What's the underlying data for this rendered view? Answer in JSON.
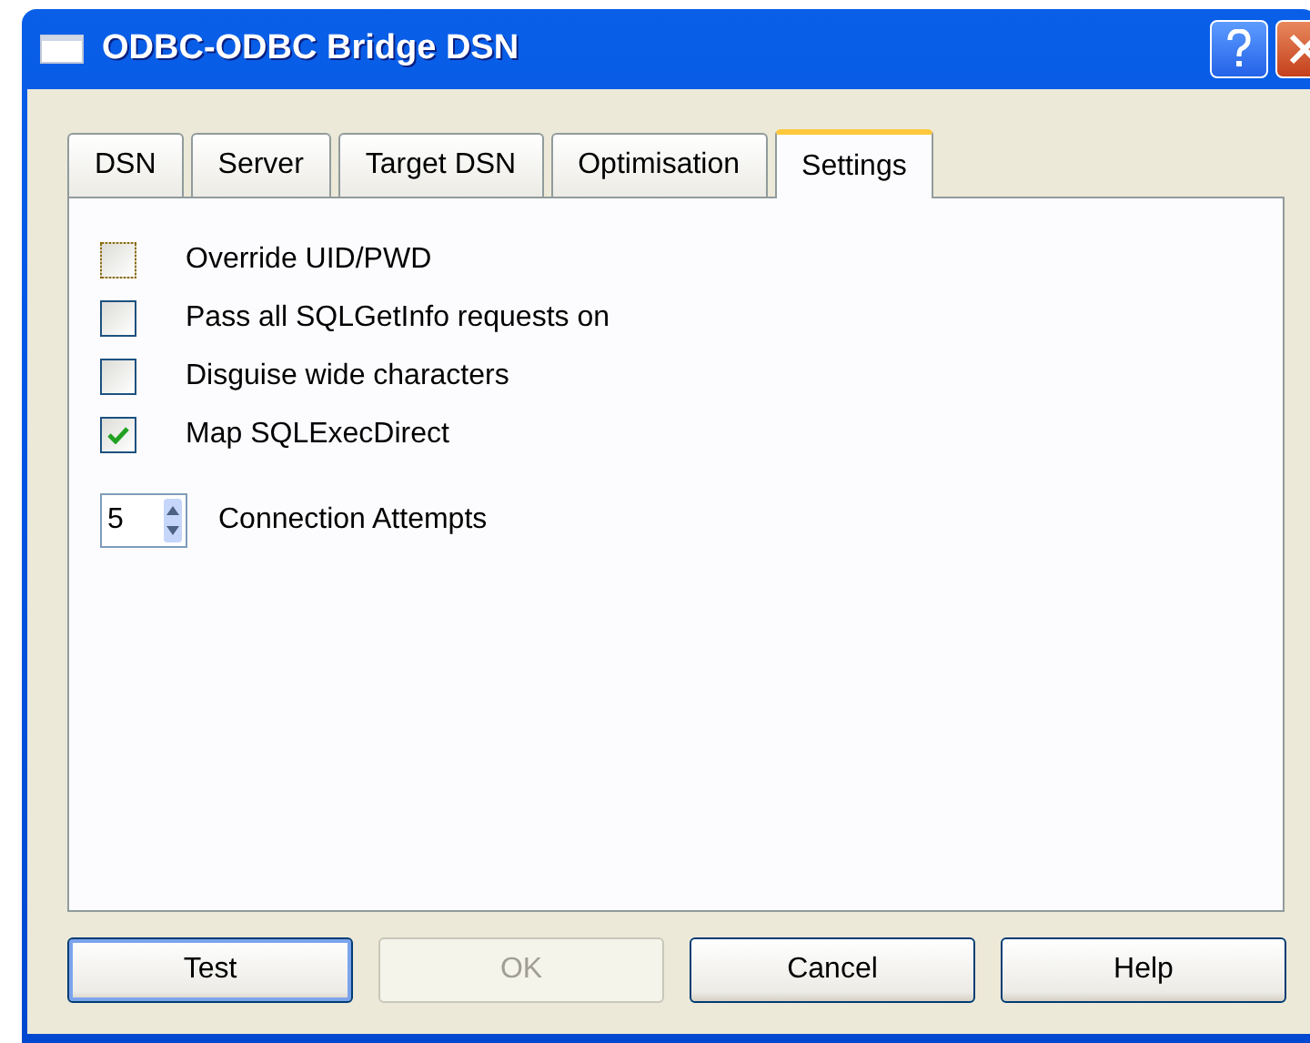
{
  "window": {
    "title": "ODBC-ODBC Bridge DSN"
  },
  "tabs": [
    {
      "label": "DSN",
      "selected": false
    },
    {
      "label": "Server",
      "selected": false
    },
    {
      "label": "Target DSN",
      "selected": false
    },
    {
      "label": "Optimisation",
      "selected": false
    },
    {
      "label": "Settings",
      "selected": true
    }
  ],
  "options": [
    {
      "label": "Override UID/PWD",
      "checked": false,
      "focused": true
    },
    {
      "label": "Pass all SQLGetInfo requests on",
      "checked": false,
      "focused": false
    },
    {
      "label": "Disguise wide characters",
      "checked": false,
      "focused": false
    },
    {
      "label": "Map SQLExecDirect",
      "checked": true,
      "focused": false
    }
  ],
  "connection_attempts": {
    "value": "5",
    "label": "Connection Attempts"
  },
  "buttons": [
    {
      "label": "Test",
      "default": true,
      "disabled": false
    },
    {
      "label": "OK",
      "default": false,
      "disabled": true
    },
    {
      "label": "Cancel",
      "default": false,
      "disabled": false
    },
    {
      "label": "Help",
      "default": false,
      "disabled": false
    }
  ]
}
